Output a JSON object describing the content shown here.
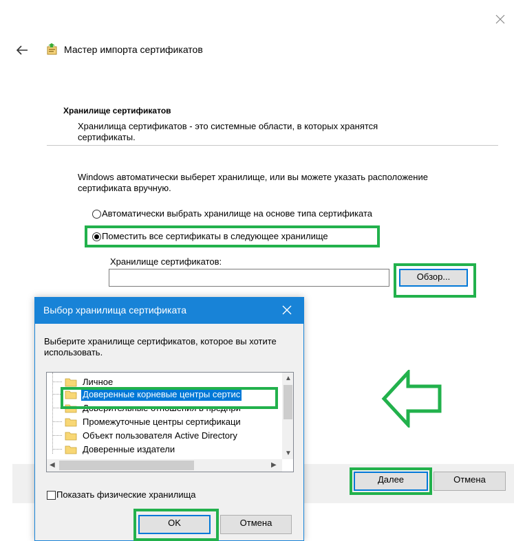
{
  "wizard": {
    "title": "Мастер импорта сертификатов",
    "section_title": "Хранилище сертификатов",
    "section_description": "Хранилища сертификатов - это системные области, в которых хранятся сертификаты.",
    "auto_text": "Windows автоматически выберет хранилище, или вы можете указать расположение сертификата вручную.",
    "radio_auto_label": "Автоматически выбрать хранилище на основе типа сертификата",
    "radio_manual_label": "Поместить все сертификаты в следующее хранилище",
    "radio_selected": "manual",
    "store_label": "Хранилище сертификатов:",
    "store_value": "",
    "browse_label": "Обзор...",
    "next_label": "Далее",
    "cancel_label": "Отмена"
  },
  "dialog": {
    "title": "Выбор хранилища сертификата",
    "prompt": "Выберите хранилище сертификатов, которое вы хотите использовать.",
    "items": [
      "Личное",
      "Доверенные корневые центры сертис",
      "Доверительные отношения в предпри",
      "Промежуточные центры сертификаци",
      "Объект пользователя Active Directory",
      "Доверенные издатели"
    ],
    "selected_index": 1,
    "show_physical_label": "Показать физические хранилища",
    "show_physical_checked": false,
    "ok_label": "OK",
    "cancel_label": "Отмена"
  },
  "colors": {
    "highlight": "#22b14c",
    "accent": "#1883d7",
    "selection": "#0078d7"
  },
  "icons": [
    "close-icon",
    "back-arrow-icon",
    "certificate-wizard-icon",
    "folder-icon",
    "scroll-arrow-icon",
    "green-arrow-left-icon"
  ]
}
